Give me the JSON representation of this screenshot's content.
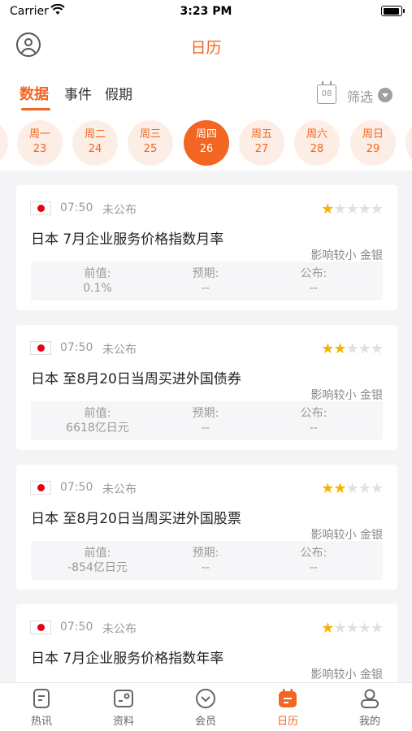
{
  "status_bar": {
    "carrier": "Carrier",
    "time": "3:23 PM"
  },
  "nav": {
    "title": "日历",
    "avatar_icon": "user-circle-icon"
  },
  "tabs": [
    {
      "label": "数据",
      "active": true
    },
    {
      "label": "事件",
      "active": false
    },
    {
      "label": "假期",
      "active": false
    }
  ],
  "calendar_icon_text": "08",
  "filter": {
    "label": "筛选"
  },
  "days": [
    {
      "weekday": "周一",
      "date": "23"
    },
    {
      "weekday": "周二",
      "date": "24"
    },
    {
      "weekday": "周三",
      "date": "25"
    },
    {
      "weekday": "周四",
      "date": "26",
      "active": true
    },
    {
      "weekday": "周五",
      "date": "27"
    },
    {
      "weekday": "周六",
      "date": "28"
    },
    {
      "weekday": "周日",
      "date": "29"
    }
  ],
  "value_labels": {
    "previous": "前值:",
    "forecast": "预期:",
    "actual": "公布:"
  },
  "events": [
    {
      "time": "07:50",
      "status": "未公布",
      "stars": 1,
      "title": "日本 7月企业服务价格指数月率",
      "impact": "影响较小 金银",
      "previous": "0.1%",
      "forecast": "--",
      "actual": "--"
    },
    {
      "time": "07:50",
      "status": "未公布",
      "stars": 2,
      "title": "日本 至8月20日当周买进外国债券",
      "impact": "影响较小 金银",
      "previous": "6618亿日元",
      "forecast": "--",
      "actual": "--"
    },
    {
      "time": "07:50",
      "status": "未公布",
      "stars": 2,
      "title": "日本 至8月20日当周买进外国股票",
      "impact": "影响较小 金银",
      "previous": "-854亿日元",
      "forecast": "--",
      "actual": "--"
    },
    {
      "time": "07:50",
      "status": "未公布",
      "stars": 1,
      "title": "日本 7月企业服务价格指数年率",
      "impact": "影响较小 金银",
      "previous": "",
      "forecast": "",
      "actual": ""
    }
  ],
  "colors": {
    "accent": "#f26522",
    "star_on": "#f5b400",
    "flag_red": "#e60012"
  },
  "tabbar": [
    {
      "label": "热讯",
      "icon": "news-icon",
      "active": false
    },
    {
      "label": "资料",
      "icon": "data-icon",
      "active": false
    },
    {
      "label": "会员",
      "icon": "member-icon",
      "active": false
    },
    {
      "label": "日历",
      "icon": "calendar-icon",
      "active": true
    },
    {
      "label": "我的",
      "icon": "profile-icon",
      "active": false
    }
  ]
}
